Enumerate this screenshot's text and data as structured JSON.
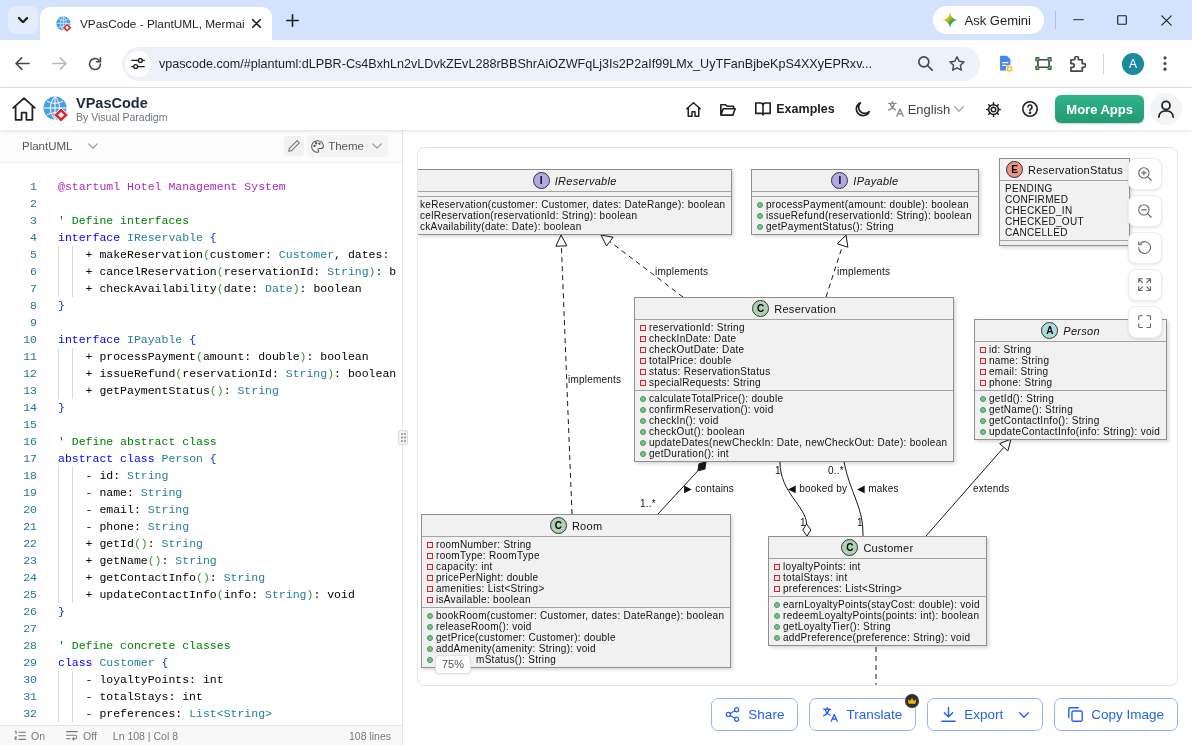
{
  "browser": {
    "tabs": [
      {
        "title": "VPasCode - PlantUML, Mermai",
        "selected": true
      }
    ],
    "ask_gemini": "Ask Gemini",
    "forward_disabled": true,
    "address": "vpascode.com/#plantuml:dLPBR-Cs4BxhLn2vLDvkZEvL288rBBShrAiOZWFqLj3Is2P2aIf99LMx_UyTFanBjbeKpS4XXyEPRxv...",
    "profile_initial": "A"
  },
  "header": {
    "brand": "VPasCode",
    "byline": "By Visual Paradigm",
    "examples": "Examples",
    "language": "English",
    "more_apps": "More Apps"
  },
  "editor": {
    "language": "PlantUML",
    "theme": "Theme",
    "lines": [
      {
        "number": "1",
        "segments": [
          {
            "text": "@startuml Hotel Management System",
            "kind": "directive"
          }
        ]
      },
      {
        "number": "2"
      },
      {
        "number": "3",
        "segments": [
          {
            "text": "' Define interfaces",
            "kind": "comment"
          }
        ]
      },
      {
        "number": "4",
        "segments": [
          {
            "text": "interface ",
            "kind": "keyword"
          },
          {
            "text": "IReservable ",
            "kind": "type"
          },
          {
            "text": "{",
            "kind": "brace"
          }
        ]
      },
      {
        "number": "5",
        "segments": [
          {
            "text": "    + makeReservation",
            "kind": "plain"
          },
          {
            "text": "(",
            "kind": "paren"
          },
          {
            "text": "customer: ",
            "kind": "plain"
          },
          {
            "text": "Customer",
            "kind": "type"
          },
          {
            "text": ", dates:",
            "kind": "plain"
          }
        ]
      },
      {
        "number": "6",
        "segments": [
          {
            "text": "    + cancelReservation",
            "kind": "plain"
          },
          {
            "text": "(",
            "kind": "paren"
          },
          {
            "text": "reservationId: ",
            "kind": "plain"
          },
          {
            "text": "String",
            "kind": "type"
          },
          {
            "text": ")",
            "kind": "paren"
          },
          {
            "text": ": b",
            "kind": "plain"
          }
        ]
      },
      {
        "number": "7",
        "segments": [
          {
            "text": "    + checkAvailability",
            "kind": "plain"
          },
          {
            "text": "(",
            "kind": "paren"
          },
          {
            "text": "date: ",
            "kind": "plain"
          },
          {
            "text": "Date",
            "kind": "type"
          },
          {
            "text": ")",
            "kind": "paren"
          },
          {
            "text": ": boolean",
            "kind": "plain"
          }
        ]
      },
      {
        "number": "8",
        "segments": [
          {
            "text": "}",
            "kind": "brace"
          }
        ]
      },
      {
        "number": "9"
      },
      {
        "number": "10",
        "segments": [
          {
            "text": "interface ",
            "kind": "keyword"
          },
          {
            "text": "IPayable ",
            "kind": "type"
          },
          {
            "text": "{",
            "kind": "brace"
          }
        ]
      },
      {
        "number": "11",
        "segments": [
          {
            "text": "    + processPayment",
            "kind": "plain"
          },
          {
            "text": "(",
            "kind": "paren"
          },
          {
            "text": "amount: double",
            "kind": "plain"
          },
          {
            "text": ")",
            "kind": "paren"
          },
          {
            "text": ": boolean",
            "kind": "plain"
          }
        ]
      },
      {
        "number": "12",
        "segments": [
          {
            "text": "    + issueRefund",
            "kind": "plain"
          },
          {
            "text": "(",
            "kind": "paren"
          },
          {
            "text": "reservationId: ",
            "kind": "plain"
          },
          {
            "text": "String",
            "kind": "type"
          },
          {
            "text": ")",
            "kind": "paren"
          },
          {
            "text": ": boolean",
            "kind": "plain"
          }
        ]
      },
      {
        "number": "13",
        "segments": [
          {
            "text": "    + getPaymentStatus",
            "kind": "plain"
          },
          {
            "text": "()",
            "kind": "paren"
          },
          {
            "text": ": ",
            "kind": "plain"
          },
          {
            "text": "String",
            "kind": "type"
          }
        ]
      },
      {
        "number": "14",
        "segments": [
          {
            "text": "}",
            "kind": "brace"
          }
        ]
      },
      {
        "number": "15"
      },
      {
        "number": "16",
        "segments": [
          {
            "text": "' Define abstract class",
            "kind": "comment"
          }
        ]
      },
      {
        "number": "17",
        "segments": [
          {
            "text": "abstract class ",
            "kind": "keyword"
          },
          {
            "text": "Person ",
            "kind": "type"
          },
          {
            "text": "{",
            "kind": "brace"
          }
        ]
      },
      {
        "number": "18",
        "segments": [
          {
            "text": "    - id: ",
            "kind": "plain"
          },
          {
            "text": "String",
            "kind": "type"
          }
        ]
      },
      {
        "number": "19",
        "segments": [
          {
            "text": "    - name: ",
            "kind": "plain"
          },
          {
            "text": "String",
            "kind": "type"
          }
        ]
      },
      {
        "number": "20",
        "segments": [
          {
            "text": "    - email: ",
            "kind": "plain"
          },
          {
            "text": "String",
            "kind": "type"
          }
        ]
      },
      {
        "number": "21",
        "segments": [
          {
            "text": "    - phone: ",
            "kind": "plain"
          },
          {
            "text": "String",
            "kind": "type"
          }
        ]
      },
      {
        "number": "22",
        "segments": [
          {
            "text": "    + getId",
            "kind": "plain"
          },
          {
            "text": "()",
            "kind": "paren"
          },
          {
            "text": ": ",
            "kind": "plain"
          },
          {
            "text": "String",
            "kind": "type"
          }
        ]
      },
      {
        "number": "23",
        "segments": [
          {
            "text": "    + getName",
            "kind": "plain"
          },
          {
            "text": "()",
            "kind": "paren"
          },
          {
            "text": ": ",
            "kind": "plain"
          },
          {
            "text": "String",
            "kind": "type"
          }
        ]
      },
      {
        "number": "24",
        "segments": [
          {
            "text": "    + getContactInfo",
            "kind": "plain"
          },
          {
            "text": "()",
            "kind": "paren"
          },
          {
            "text": ": ",
            "kind": "plain"
          },
          {
            "text": "String",
            "kind": "type"
          }
        ]
      },
      {
        "number": "25",
        "segments": [
          {
            "text": "    + updateContactInfo",
            "kind": "plain"
          },
          {
            "text": "(",
            "kind": "paren"
          },
          {
            "text": "info: ",
            "kind": "plain"
          },
          {
            "text": "String",
            "kind": "type"
          },
          {
            "text": ")",
            "kind": "paren"
          },
          {
            "text": ": void",
            "kind": "plain"
          }
        ]
      },
      {
        "number": "26",
        "segments": [
          {
            "text": "}",
            "kind": "brace"
          }
        ]
      },
      {
        "number": "27"
      },
      {
        "number": "28",
        "segments": [
          {
            "text": "' Define concrete classes",
            "kind": "comment"
          }
        ]
      },
      {
        "number": "29",
        "segments": [
          {
            "text": "class ",
            "kind": "keyword"
          },
          {
            "text": "Customer ",
            "kind": "type"
          },
          {
            "text": "{",
            "kind": "brace"
          }
        ]
      },
      {
        "number": "30",
        "segments": [
          {
            "text": "    - loyaltyPoints: int",
            "kind": "plain"
          }
        ]
      },
      {
        "number": "31",
        "segments": [
          {
            "text": "    - totalStays: int",
            "kind": "plain"
          }
        ]
      },
      {
        "number": "32",
        "segments": [
          {
            "text": "    - preferences: ",
            "kind": "plain"
          },
          {
            "text": "List<String>",
            "kind": "type"
          }
        ]
      }
    ],
    "status_bar": {
      "line_numbers": "On",
      "word_wrap": "Off",
      "cursor": "Ln 108 | Col 8",
      "line_count": "108 lines"
    }
  },
  "diagram": {
    "classes": [
      {
        "kind": "interface",
        "badge": "I",
        "name": "IReservable",
        "methods": [
          {
            "text": "keReservation(customer: Customer, dates: DateRange): boolean"
          },
          {
            "text": "celReservation(reservationId: String): boolean"
          },
          {
            "text": "ckAvailability(date: Date): boolean"
          }
        ]
      },
      {
        "kind": "interface",
        "badge": "I",
        "name": "IPayable",
        "methods": [
          {
            "kind": "public",
            "text": "processPayment(amount: double): boolean"
          },
          {
            "kind": "public",
            "text": "issueRefund(reservationId: String): boolean"
          },
          {
            "kind": "public",
            "text": "getPaymentStatus(): String"
          }
        ]
      },
      {
        "kind": "enum",
        "badge": "E",
        "name": "ReservationStatus",
        "values": [
          "PENDING",
          "CONFIRMED",
          "CHECKED_IN",
          "CHECKED_OUT",
          "CANCELLED"
        ]
      },
      {
        "kind": "class",
        "badge": "C",
        "name": "Reservation",
        "fields": [
          {
            "kind": "private",
            "text": "reservationId: String"
          },
          {
            "kind": "private",
            "text": "checkInDate: Date"
          },
          {
            "kind": "private",
            "text": "checkOutDate: Date"
          },
          {
            "kind": "private",
            "text": "totalPrice: double"
          },
          {
            "kind": "private",
            "text": "status: ReservationStatus"
          },
          {
            "kind": "private",
            "text": "specialRequests: String"
          }
        ],
        "methods": [
          {
            "kind": "public",
            "text": "calculateTotalPrice(): double"
          },
          {
            "kind": "public",
            "text": "confirmReservation(): void"
          },
          {
            "kind": "public",
            "text": "checkIn(): void"
          },
          {
            "kind": "public",
            "text": "checkOut(): boolean"
          },
          {
            "kind": "public",
            "text": "updateDates(newCheckIn: Date, newCheckOut: Date): boolean"
          },
          {
            "kind": "public",
            "text": "getDuration(): int"
          }
        ]
      },
      {
        "kind": "abstract",
        "badge": "A",
        "name": "Person",
        "fields": [
          {
            "kind": "private",
            "text": "id: String"
          },
          {
            "kind": "private",
            "text": "name: String"
          },
          {
            "kind": "private",
            "text": "email: String"
          },
          {
            "kind": "private",
            "text": "phone: String"
          }
        ],
        "methods": [
          {
            "kind": "public",
            "text": "getId(): String"
          },
          {
            "kind": "public",
            "text": "getName(): String"
          },
          {
            "kind": "public",
            "text": "getContactInfo(): String"
          },
          {
            "kind": "public",
            "text": "updateContactInfo(info: String): void"
          }
        ]
      },
      {
        "kind": "class",
        "badge": "C",
        "name": "Room",
        "fields": [
          {
            "kind": "private",
            "text": "roomNumber: String"
          },
          {
            "kind": "private",
            "text": "roomType: RoomType"
          },
          {
            "kind": "private",
            "text": "capacity: int"
          },
          {
            "kind": "private",
            "text": "pricePerNight: double"
          },
          {
            "kind": "private",
            "text": "amenities: List<String>"
          },
          {
            "kind": "private",
            "text": "isAvailable: boolean"
          }
        ],
        "methods": [
          {
            "kind": "public",
            "text": "bookRoom(customer: Customer, dates: DateRange): boolean"
          },
          {
            "kind": "public",
            "text": "releaseRoom(): void"
          },
          {
            "kind": "public",
            "text": "getPrice(customer: Customer): double"
          },
          {
            "kind": "public",
            "text": "addAmenity(amenity: String): void"
          },
          {
            "kind": "public",
            "text": "mStatus(): String"
          }
        ]
      },
      {
        "kind": "class",
        "badge": "C",
        "name": "Customer",
        "fields": [
          {
            "kind": "private",
            "text": "loyaltyPoints: int"
          },
          {
            "kind": "private",
            "text": "totalStays: int"
          },
          {
            "kind": "private",
            "text": "preferences: List<String>"
          }
        ],
        "methods": [
          {
            "kind": "public",
            "text": "earnLoyaltyPoints(stayCost: double): void"
          },
          {
            "kind": "public",
            "text": "redeemLoyaltyPoints(points: int): boolean"
          },
          {
            "kind": "public",
            "text": "getLoyaltyTier(): String"
          },
          {
            "kind": "public",
            "text": "addPreference(preference: String): void"
          }
        ]
      }
    ],
    "relations": [
      {
        "kind": "realization",
        "label": "implements"
      },
      {
        "kind": "realization",
        "label": "implements"
      },
      {
        "kind": "realization",
        "label": "implements"
      },
      {
        "kind": "composition",
        "label": "▶ contains",
        "lower_multiplicity": "1..*"
      },
      {
        "kind": "aggregation",
        "label": "◀ booked by",
        "upper_multiplicity": "1",
        "lower_multiplicity": "1"
      },
      {
        "kind": "association",
        "label": "◀ makes",
        "upper_multiplicity": "0..*",
        "lower_multiplicity": "1"
      },
      {
        "kind": "generalization",
        "label": "extends"
      },
      {
        "kind": "dependency"
      }
    ],
    "zoom_level": "75%"
  },
  "actions": [
    {
      "kind": "share",
      "label": "Share"
    },
    {
      "kind": "translate",
      "label": "Translate",
      "premium": true
    },
    {
      "kind": "export",
      "label": "Export",
      "menu": true
    },
    {
      "kind": "copy",
      "label": "Copy Image"
    }
  ]
}
